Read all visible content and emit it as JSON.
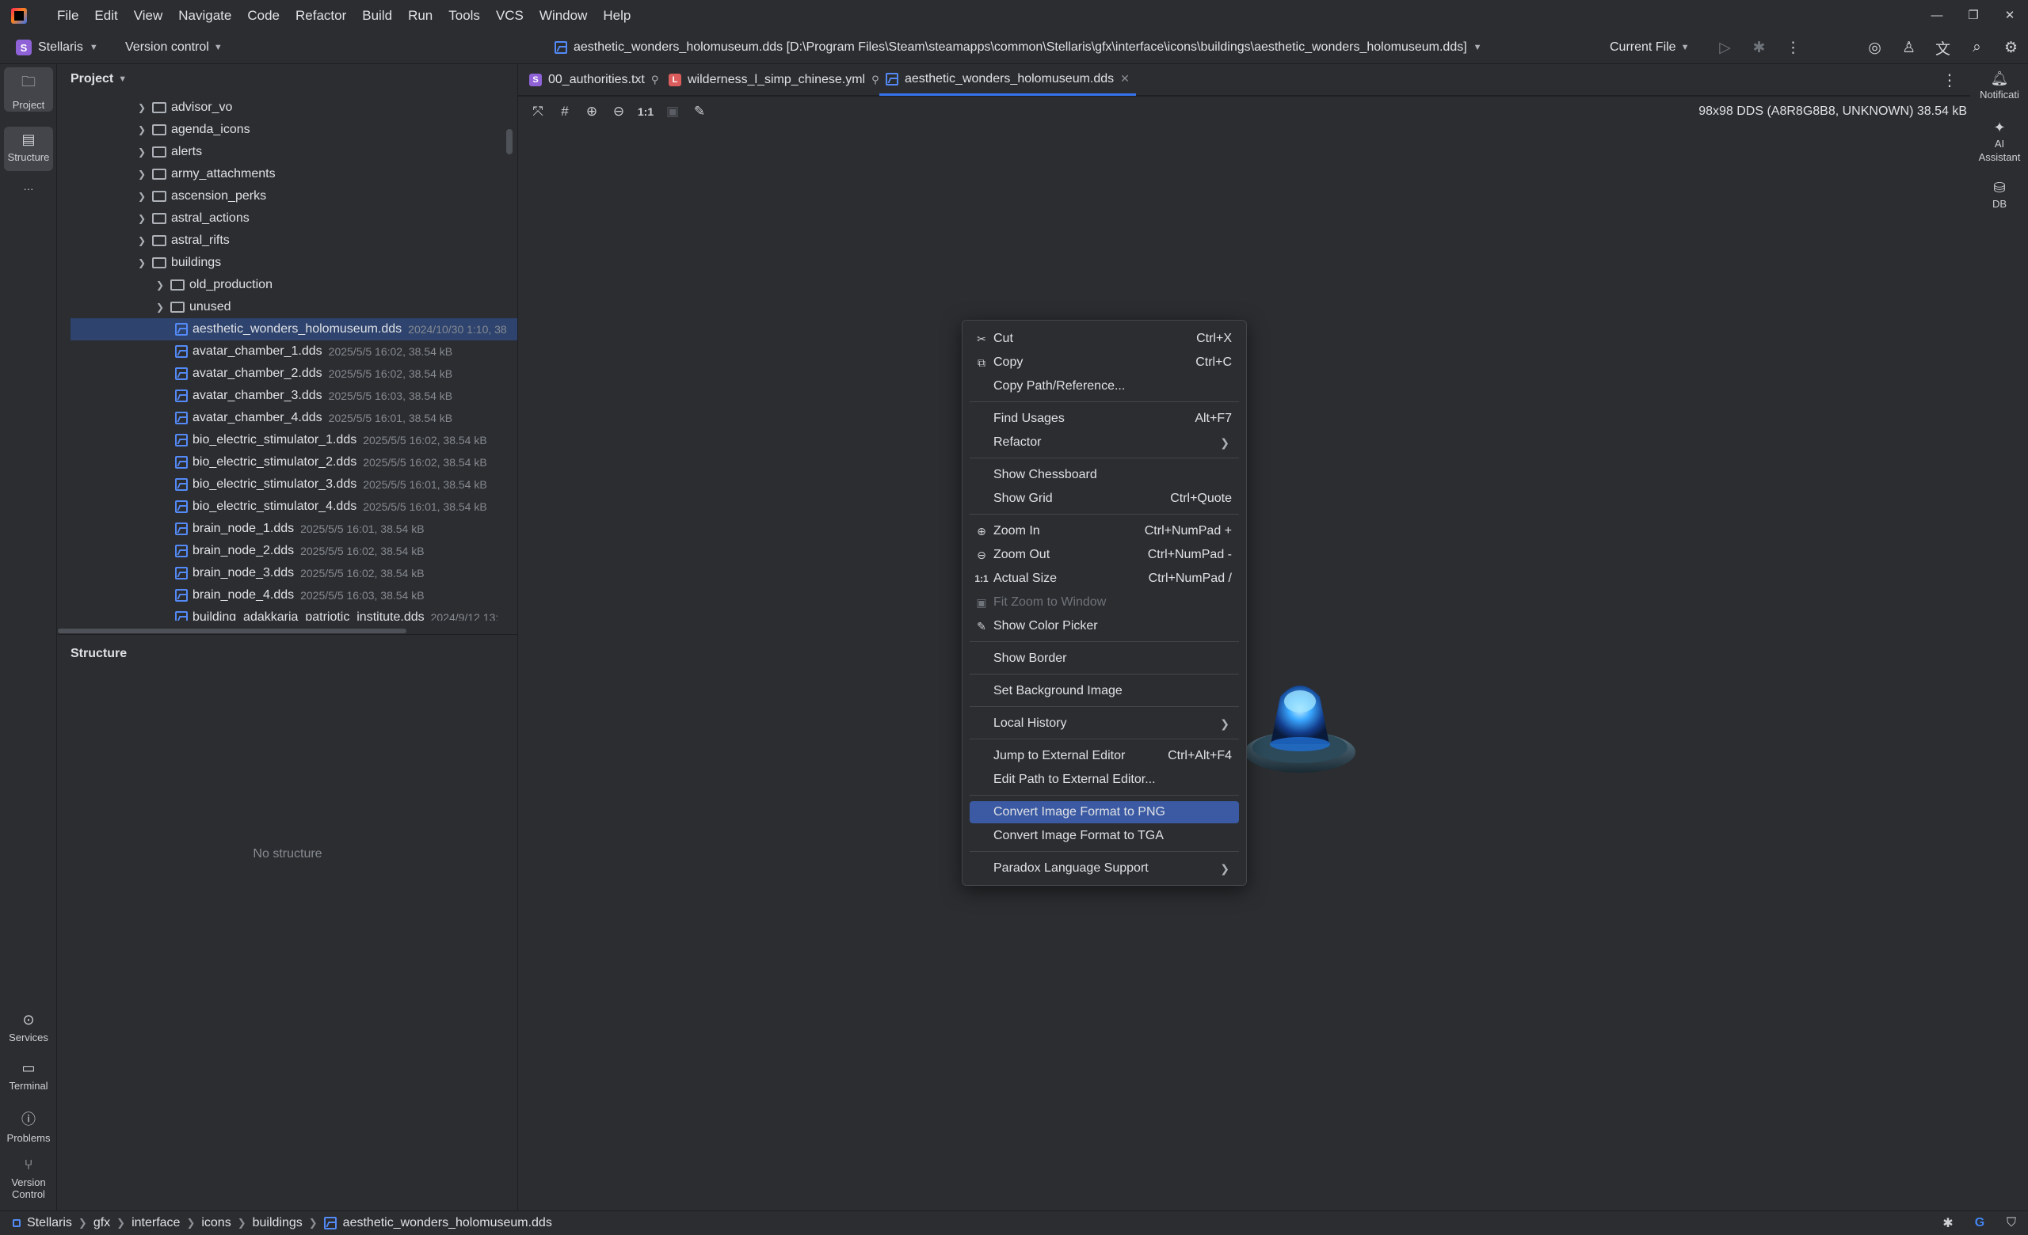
{
  "app": {
    "menu": [
      "File",
      "Edit",
      "View",
      "Navigate",
      "Code",
      "Refactor",
      "Build",
      "Run",
      "Tools",
      "VCS",
      "Window",
      "Help"
    ],
    "window_controls": {
      "minimize": "—",
      "restore": "❐",
      "close": "✕"
    }
  },
  "toolbar": {
    "project_badge": "S",
    "project_name": "Stellaris",
    "vcs_label": "Version control",
    "file_title": "aesthetic_wonders_holomuseum.dds [D:\\Program Files\\Steam\\steamapps\\common\\Stellaris\\gfx\\interface\\icons\\buildings\\aesthetic_wonders_holomuseum.dds]",
    "run_config": "Current File"
  },
  "left_strip": {
    "project": "Project",
    "structure": "Structure",
    "more": "···",
    "services": "Services",
    "terminal": "Terminal",
    "problems": "Problems",
    "version_control_1": "Version",
    "version_control_2": "Control"
  },
  "right_strip": {
    "notifications": "Notificati",
    "ai_1": "AI",
    "ai_2": "Assistant",
    "db": "DB"
  },
  "project_panel": {
    "title": "Project",
    "folders": [
      {
        "name": "advisor_vo"
      },
      {
        "name": "agenda_icons"
      },
      {
        "name": "alerts"
      },
      {
        "name": "army_attachments"
      },
      {
        "name": "ascension_perks"
      },
      {
        "name": "astral_actions"
      },
      {
        "name": "astral_rifts"
      },
      {
        "name": "buildings"
      },
      {
        "name": "old_production"
      },
      {
        "name": "unused"
      }
    ],
    "files": [
      {
        "name": "aesthetic_wonders_holomuseum.dds",
        "meta": "2024/10/30 1:10, 38"
      },
      {
        "name": "avatar_chamber_1.dds",
        "meta": "2025/5/5 16:02, 38.54 kB"
      },
      {
        "name": "avatar_chamber_2.dds",
        "meta": "2025/5/5 16:02, 38.54 kB"
      },
      {
        "name": "avatar_chamber_3.dds",
        "meta": "2025/5/5 16:03, 38.54 kB"
      },
      {
        "name": "avatar_chamber_4.dds",
        "meta": "2025/5/5 16:01, 38.54 kB"
      },
      {
        "name": "bio_electric_stimulator_1.dds",
        "meta": "2025/5/5 16:02, 38.54 kB"
      },
      {
        "name": "bio_electric_stimulator_2.dds",
        "meta": "2025/5/5 16:02, 38.54 kB"
      },
      {
        "name": "bio_electric_stimulator_3.dds",
        "meta": "2025/5/5 16:01, 38.54 kB"
      },
      {
        "name": "bio_electric_stimulator_4.dds",
        "meta": "2025/5/5 16:01, 38.54 kB"
      },
      {
        "name": "brain_node_1.dds",
        "meta": "2025/5/5 16:01, 38.54 kB"
      },
      {
        "name": "brain_node_2.dds",
        "meta": "2025/5/5 16:02, 38.54 kB"
      },
      {
        "name": "brain_node_3.dds",
        "meta": "2025/5/5 16:02, 38.54 kB"
      },
      {
        "name": "brain_node_4.dds",
        "meta": "2025/5/5 16:03, 38.54 kB"
      },
      {
        "name": "building_adakkaria_patriotic_institute.dds",
        "meta": "2024/9/12 13:"
      }
    ]
  },
  "structure_panel": {
    "title": "Structure",
    "empty_text": "No structure"
  },
  "tabs": [
    {
      "label": "00_authorities.txt",
      "badge": "S",
      "badge_color": "#8f62d7"
    },
    {
      "label": "wilderness_l_simp_chinese.yml",
      "badge": "L",
      "badge_color": "#db5c5c"
    },
    {
      "label": "aesthetic_wonders_holomuseum.dds"
    }
  ],
  "image_info": "98x98 DDS (A8R8G8B8, UNKNOWN) 38.54 kB",
  "context_menu": {
    "cut": {
      "label": "Cut",
      "key": "Ctrl+X"
    },
    "copy": {
      "label": "Copy",
      "key": "Ctrl+C"
    },
    "copy_path": {
      "label": "Copy Path/Reference..."
    },
    "find_usages": {
      "label": "Find Usages",
      "key": "Alt+F7"
    },
    "refactor": {
      "label": "Refactor"
    },
    "show_chessboard": {
      "label": "Show Chessboard"
    },
    "show_grid": {
      "label": "Show Grid",
      "key": "Ctrl+Quote"
    },
    "zoom_in": {
      "label": "Zoom In",
      "key": "Ctrl+NumPad +"
    },
    "zoom_out": {
      "label": "Zoom Out",
      "key": "Ctrl+NumPad -"
    },
    "actual_size": {
      "label": "Actual Size",
      "key": "Ctrl+NumPad /",
      "icon_text": "1:1"
    },
    "fit_zoom": {
      "label": "Fit Zoom to Window"
    },
    "color_picker": {
      "label": "Show Color Picker"
    },
    "show_border": {
      "label": "Show Border"
    },
    "set_bg": {
      "label": "Set Background Image"
    },
    "local_history": {
      "label": "Local History"
    },
    "jump_external": {
      "label": "Jump to External Editor",
      "key": "Ctrl+Alt+F4"
    },
    "edit_path_external": {
      "label": "Edit Path to External Editor..."
    },
    "convert_png": {
      "label": "Convert Image Format to PNG"
    },
    "convert_tga": {
      "label": "Convert Image Format to TGA"
    },
    "paradox": {
      "label": "Paradox Language Support"
    }
  },
  "statusbar": {
    "crumbs": [
      "Stellaris",
      "gfx",
      "interface",
      "icons",
      "buildings",
      "aesthetic_wonders_holomuseum.dds"
    ]
  },
  "colors": {
    "accent": "#3574f0",
    "selection": "#2e436e",
    "menu_highlight": "#3b5aa3"
  }
}
